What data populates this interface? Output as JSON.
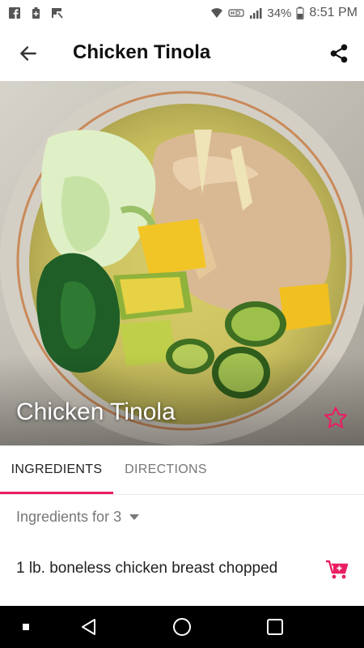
{
  "status_bar": {
    "battery": "34%",
    "time": "8:51 PM",
    "left_icons": [
      "facebook-icon",
      "battery-saver-icon",
      "flipboard-icon"
    ],
    "right_icons": [
      "wifi-icon",
      "hd-icon",
      "signal-icon",
      "battery-icon"
    ]
  },
  "app_bar": {
    "title": "Chicken Tinola",
    "back_icon": "arrow-back-icon",
    "share_icon": "share-icon"
  },
  "hero": {
    "caption": "Chicken Tinola",
    "favorite_icon": "star-outline-icon"
  },
  "tabs": [
    {
      "label": "INGREDIENTS",
      "selected": true
    },
    {
      "label": "DIRECTIONS",
      "selected": false
    }
  ],
  "servings": {
    "label": "Ingredients for 3"
  },
  "ingredients": [
    {
      "text": "1 lb. boneless chicken breast chopped",
      "action_icon": "add-to-cart-icon"
    }
  ],
  "colors": {
    "accent": "#e91e63",
    "text_primary": "#222222",
    "text_secondary": "#777777",
    "nav_bar": "#000000"
  },
  "nav_bar": {
    "items": [
      "menu-dot-icon",
      "back-triangle-icon",
      "home-circle-icon",
      "recents-square-icon"
    ]
  }
}
